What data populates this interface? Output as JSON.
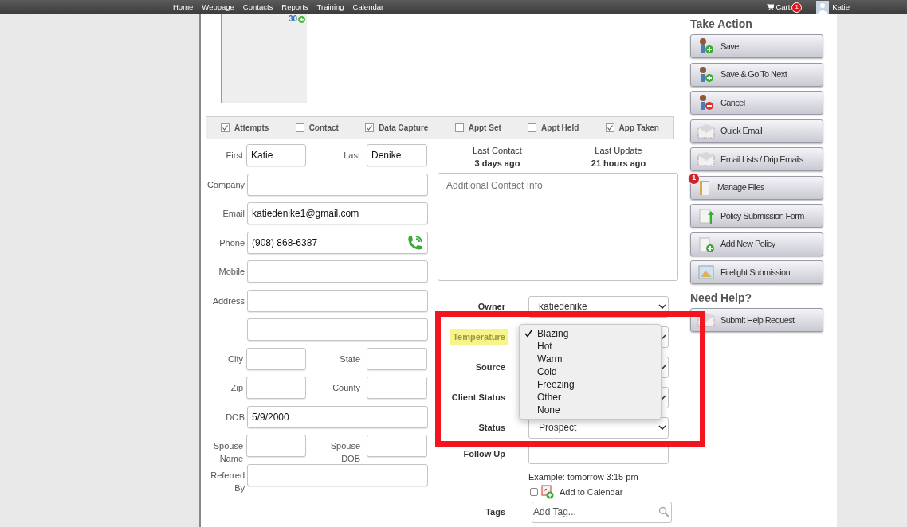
{
  "nav": {
    "items": [
      "Home",
      "Webpage",
      "Contacts",
      "Reports",
      "Training",
      "Calendar"
    ],
    "cart": {
      "label": "Cart",
      "badge": "1"
    },
    "user": "Katie"
  },
  "photo": {
    "count": "30"
  },
  "checkboxes": [
    {
      "label": "Attempts",
      "checked": true
    },
    {
      "label": "Contact",
      "checked": false
    },
    {
      "label": "Data Capture",
      "checked": true
    },
    {
      "label": "Appt Set",
      "checked": false
    },
    {
      "label": "Appt Held",
      "checked": false
    },
    {
      "label": "App Taken",
      "checked": true
    }
  ],
  "contact_rows": [
    {
      "kind": "pair",
      "fields": [
        {
          "label": "First",
          "value": "Katie"
        },
        {
          "label": "Last",
          "value": "Denike"
        }
      ]
    },
    {
      "kind": "full",
      "label": "Company"
    },
    {
      "kind": "full",
      "label": "Email",
      "value": "katiedenike1@gmail.com"
    },
    {
      "kind": "phone",
      "label": "Phone",
      "value": "(908) 868-6387"
    },
    {
      "kind": "full",
      "label": "Mobile"
    },
    {
      "kind": "full",
      "label": "Address"
    },
    {
      "kind": "full"
    },
    {
      "kind": "pair",
      "fields": [
        {
          "label": "City"
        },
        {
          "label": "State"
        }
      ]
    },
    {
      "kind": "pair",
      "fields": [
        {
          "label": "Zip"
        },
        {
          "label": "County"
        }
      ]
    },
    {
      "kind": "full",
      "label": "DOB",
      "value": "5/9/2000"
    },
    {
      "kind": "pair",
      "fields": [
        {
          "label": "Spouse Name"
        },
        {
          "label": "Spouse DOB"
        }
      ]
    },
    {
      "kind": "full",
      "label": "Referred By"
    }
  ],
  "last_contact": {
    "label": "Last Contact",
    "value": "3 days ago"
  },
  "last_update": {
    "label": "Last Update",
    "value": "21 hours ago"
  },
  "notes": {
    "placeholder": "Additional Contact Info"
  },
  "selects": [
    {
      "label": "Owner",
      "value": "katiedenike",
      "highlighted": false
    },
    {
      "label": "Temperature",
      "highlighted": true
    },
    {
      "label": "Source",
      "highlighted": false
    },
    {
      "label": "Client Status",
      "highlighted": false
    },
    {
      "label": "Status",
      "value": "Prospect",
      "highlighted": false
    }
  ],
  "temperature_menu": [
    {
      "label": "Blazing",
      "selected": true
    },
    {
      "label": "Hot",
      "selected": false
    },
    {
      "label": "Warm",
      "selected": false
    },
    {
      "label": "Cold",
      "selected": false
    },
    {
      "label": "Freezing",
      "selected": false
    },
    {
      "label": "Other",
      "selected": false
    },
    {
      "label": "None",
      "selected": false
    }
  ],
  "follow_up": {
    "label": "Follow Up",
    "hint": "Example: tomorrow 3:15 pm"
  },
  "add_to_calendar": {
    "label": "Add to Calendar",
    "checked": false
  },
  "tags": {
    "label": "Tags",
    "placeholder": "Add Tag..."
  },
  "take_action": {
    "title": "Take Action",
    "buttons": [
      {
        "label": "Save",
        "kind": "personadd"
      },
      {
        "label": "Save & Go To Next",
        "kind": "personadd"
      },
      {
        "label": "Cancel",
        "kind": "personremove"
      },
      {
        "label": "Quick Email",
        "kind": "email"
      },
      {
        "label": "Email Lists / Drip Emails",
        "kind": "email"
      },
      {
        "label": "Manage Files",
        "kind": "files",
        "badge": "1"
      },
      {
        "label": "Policy Submission Form",
        "kind": "upload"
      },
      {
        "label": "Add New Policy",
        "kind": "newpolicy"
      },
      {
        "label": "Firelight Submission",
        "kind": "firelight"
      }
    ]
  },
  "need_help": {
    "title": "Need Help?",
    "buttons": [
      {
        "label": "Submit Help Request",
        "kind": "email"
      }
    ]
  }
}
